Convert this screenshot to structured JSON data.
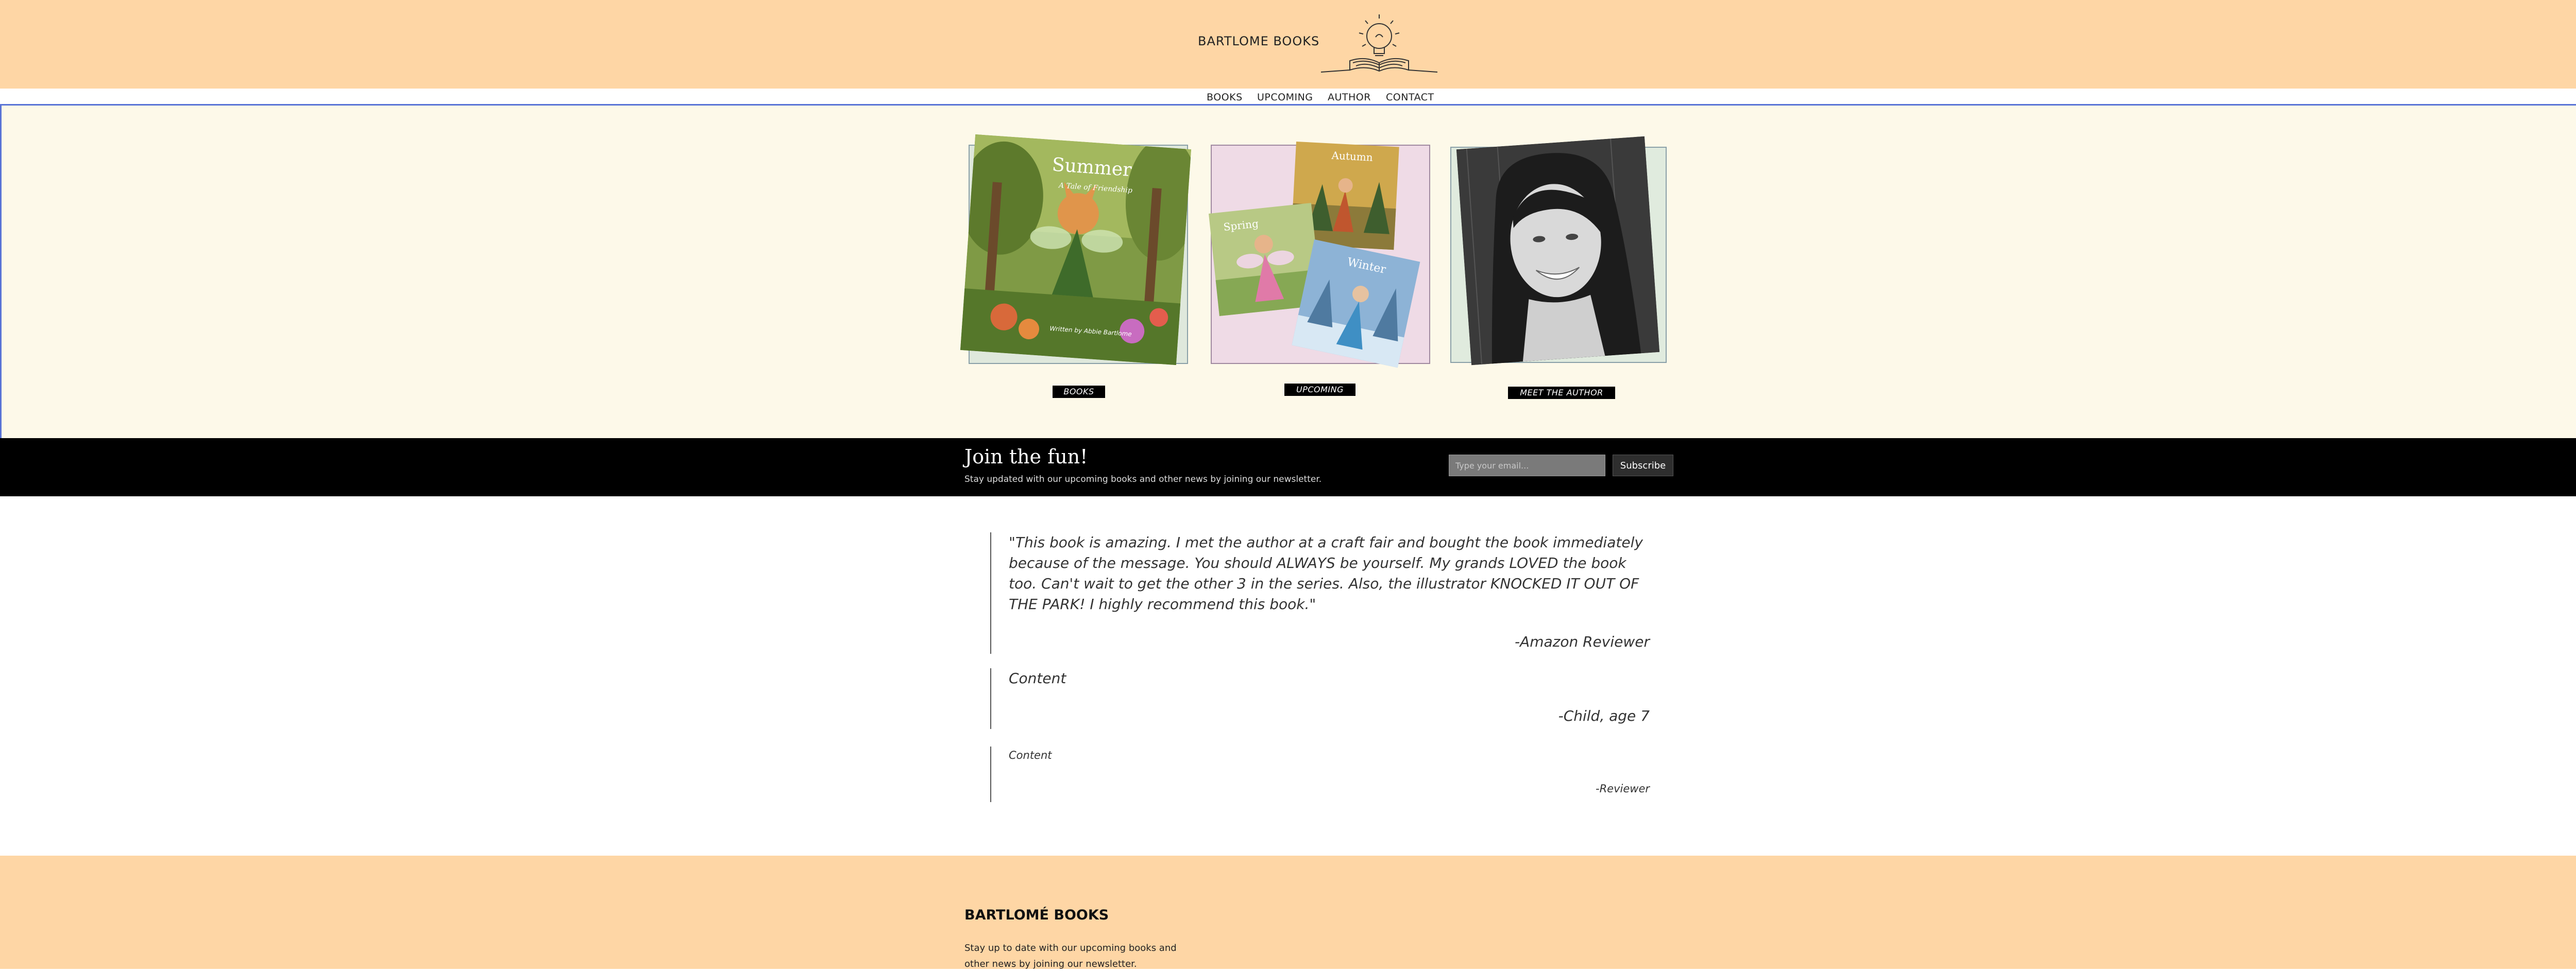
{
  "header": {
    "brand": "BARTLOME BOOKS",
    "logo_icon": "lightbulb-book-logo-icon",
    "background": "#fed6a5"
  },
  "nav": {
    "items": [
      {
        "label": "BOOKS"
      },
      {
        "label": "UPCOMING"
      },
      {
        "label": "AUTHOR"
      },
      {
        "label": "CONTACT"
      }
    ]
  },
  "hero": {
    "background": "#fdf9e9",
    "cards": [
      {
        "label": "BOOKS",
        "image": "summer-book-cover",
        "cover_title": "Summer",
        "cover_subtitle": "A Tale of Friendship",
        "cover_byline": "Written by Abbie Bartlome"
      },
      {
        "label": "UPCOMING",
        "image": "upcoming-book-covers",
        "covers": [
          "Autumn",
          "Spring",
          "Winter"
        ]
      },
      {
        "label": "MEET THE AUTHOR",
        "image": "author-portrait-photo"
      }
    ]
  },
  "newsletter": {
    "title": "Join the fun!",
    "subtitle": "Stay updated with our upcoming books and other news by joining our newsletter.",
    "email_placeholder": "Type your email...",
    "subscribe_label": "Subscribe"
  },
  "testimonials": [
    {
      "quote": "\"This book is amazing. I met the author at a craft fair and bought the book immediately because of the message. You should ALWAYS be yourself. My grands LOVED the book too. Can't wait to get the other 3 in the series. Also, the illustrator KNOCKED IT OUT OF THE PARK! I highly recommend this book.\"",
      "author": "-Amazon Reviewer"
    },
    {
      "quote": "Content",
      "author": "-Child, age 7"
    },
    {
      "quote": "Content",
      "author": "-Reviewer"
    }
  ],
  "footer": {
    "brand": "BARTLOMÉ BOOKS",
    "text": "Stay up to date with our upcoming books and other news by joining our newsletter."
  }
}
